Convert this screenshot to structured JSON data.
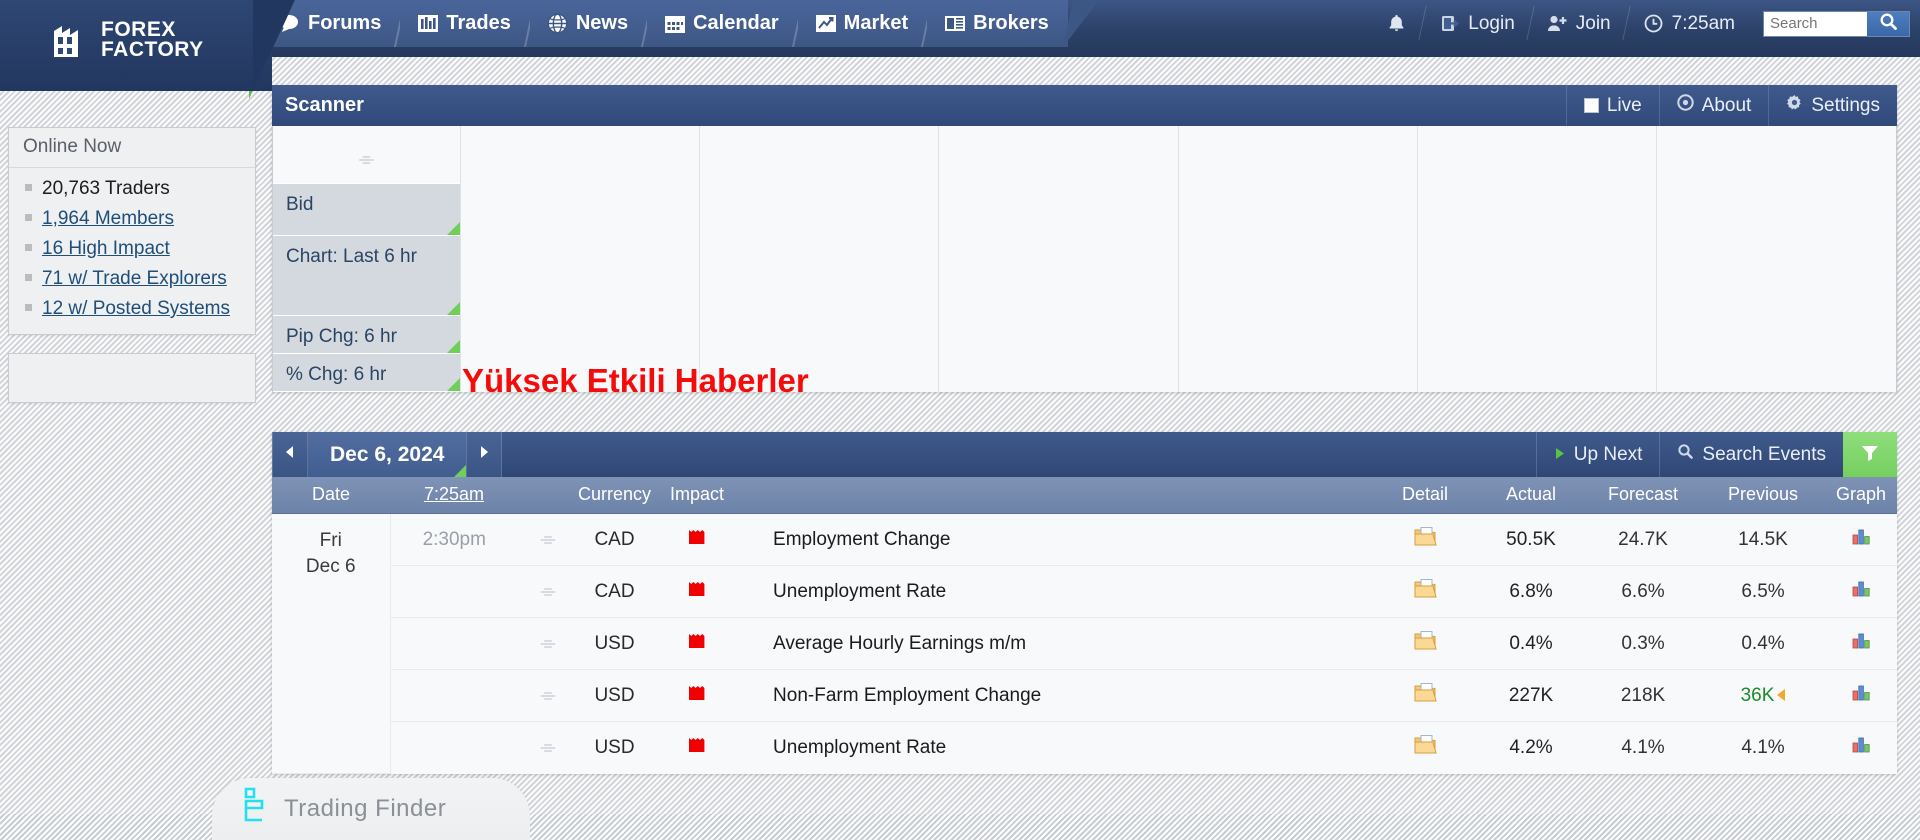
{
  "header": {
    "logo": {
      "line1": "FOREX",
      "line2": "FACTORY",
      "icon": "factory-logo-icon"
    },
    "nav": [
      {
        "label": "Forums",
        "icon": "speech-bubble-icon"
      },
      {
        "label": "Trades",
        "icon": "bar-chart-icon"
      },
      {
        "label": "News",
        "icon": "globe-icon"
      },
      {
        "label": "Calendar",
        "icon": "calendar-icon"
      },
      {
        "label": "Market",
        "icon": "market-chart-icon"
      },
      {
        "label": "Brokers",
        "icon": "brokers-icon"
      }
    ],
    "notifications_icon": "bell-icon",
    "login": {
      "label": "Login",
      "icon": "login-icon"
    },
    "join": {
      "label": "Join",
      "icon": "person-plus-icon"
    },
    "clock": {
      "label": "7:25am",
      "icon": "clock-icon"
    },
    "search": {
      "value": "",
      "placeholder": "Search",
      "button_icon": "search-icon"
    }
  },
  "sidebar": {
    "title": "Online Now",
    "items": [
      {
        "label": "20,763 Traders",
        "link": false
      },
      {
        "label": "1,964 Members",
        "link": true
      },
      {
        "label": "16 High Impact",
        "link": true
      },
      {
        "label": "71 w/ Trade Explorers",
        "link": true
      },
      {
        "label": "12 w/ Posted Systems",
        "link": true
      }
    ]
  },
  "scanner": {
    "title": "Scanner",
    "tools": [
      {
        "label": "Live",
        "icon": "checkbox-icon"
      },
      {
        "label": "About",
        "icon": "about-circle-icon"
      },
      {
        "label": "Settings",
        "icon": "gear-icon"
      }
    ],
    "rows": [
      {
        "label": "",
        "type": "speaker"
      },
      {
        "label": "Bid",
        "type": "data"
      },
      {
        "label": "Chart: Last 6 hr",
        "type": "data"
      },
      {
        "label": "Pip Chg: 6 hr",
        "type": "data"
      },
      {
        "label": "% Chg: 6 hr",
        "type": "data"
      }
    ],
    "column_count": 6
  },
  "annotation": {
    "text": "Yüksek Etkili Haberler",
    "color": "#f60b0b"
  },
  "calendar": {
    "prev_icon": "chevron-left-icon",
    "next_icon": "chevron-right-icon",
    "date_label": "Dec 6, 2024",
    "up_next": {
      "label": "Up Next",
      "icon": "play-icon"
    },
    "search_events": {
      "label": "Search Events",
      "icon": "search-icon"
    },
    "filter": {
      "icon": "funnel-icon"
    },
    "columns": [
      "Date",
      "7:25am",
      "Currency",
      "Impact",
      "",
      "Detail",
      "Actual",
      "Forecast",
      "Previous",
      "Graph"
    ],
    "time_header_link": "7:25am",
    "rows": [
      {
        "date_day": "Fri",
        "date_num": "Dec 6",
        "time": "2:30pm",
        "speaker_icon": "speaker-icon",
        "currency": "CAD",
        "impact": "high",
        "event": "Employment Change",
        "detail_icon": "folder-icon",
        "actual": "50.5K",
        "actual_state": "positive",
        "forecast": "24.7K",
        "previous": "14.5K",
        "previous_state": "neutral",
        "previous_revised": false,
        "graph_icon": "bar-graph-icon"
      },
      {
        "date_day": "",
        "date_num": "",
        "time": "",
        "speaker_icon": "speaker-icon",
        "currency": "CAD",
        "impact": "high",
        "event": "Unemployment Rate",
        "detail_icon": "folder-icon",
        "actual": "6.8%",
        "actual_state": "negative",
        "forecast": "6.6%",
        "previous": "6.5%",
        "previous_state": "neutral",
        "previous_revised": false,
        "graph_icon": "bar-graph-icon"
      },
      {
        "date_day": "",
        "date_num": "",
        "time": "",
        "speaker_icon": "speaker-icon",
        "currency": "USD",
        "impact": "high",
        "event": "Average Hourly Earnings m/m",
        "detail_icon": "folder-icon",
        "actual": "0.4%",
        "actual_state": "positive",
        "forecast": "0.3%",
        "previous": "0.4%",
        "previous_state": "neutral",
        "previous_revised": false,
        "graph_icon": "bar-graph-icon"
      },
      {
        "date_day": "",
        "date_num": "",
        "time": "",
        "speaker_icon": "speaker-icon",
        "currency": "USD",
        "impact": "high",
        "event": "Non-Farm Employment Change",
        "detail_icon": "folder-icon",
        "actual": "227K",
        "actual_state": "positive",
        "forecast": "218K",
        "previous": "36K",
        "previous_state": "positive",
        "previous_revised": true,
        "graph_icon": "bar-graph-icon"
      },
      {
        "date_day": "",
        "date_num": "",
        "time": "",
        "speaker_icon": "speaker-icon",
        "currency": "USD",
        "impact": "high",
        "event": "Unemployment Rate",
        "detail_icon": "folder-icon",
        "actual": "4.2%",
        "actual_state": "negative",
        "forecast": "4.1%",
        "previous": "4.1%",
        "previous_state": "neutral",
        "previous_revised": false,
        "graph_icon": "bar-graph-icon"
      }
    ]
  },
  "watermark": {
    "text": "Trading Finder",
    "icon": "trading-finder-logo-icon"
  }
}
